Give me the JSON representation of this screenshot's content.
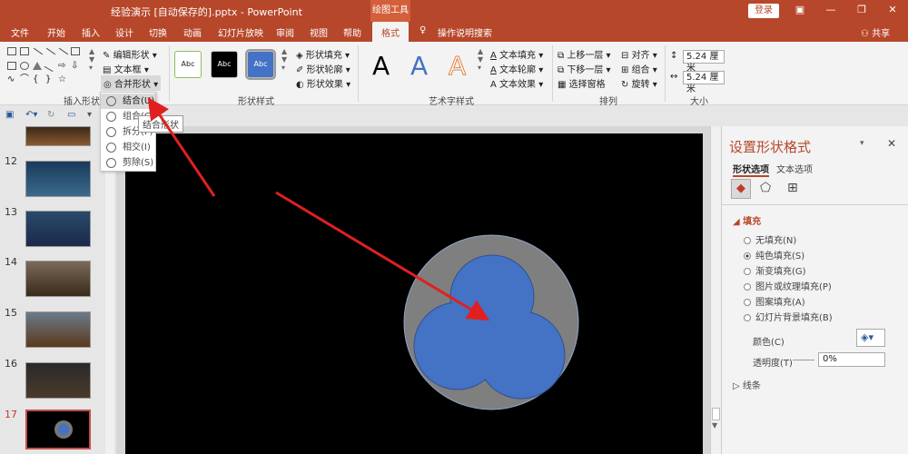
{
  "titlebar": {
    "title": "经验演示 [自动保存的].pptx - PowerPoint",
    "context_tool": "绘图工具",
    "login": "登录",
    "share": "共享"
  },
  "tabs": [
    "文件",
    "开始",
    "插入",
    "设计",
    "切换",
    "动画",
    "幻灯片放映",
    "审阅",
    "视图",
    "帮助",
    "格式"
  ],
  "tell_me": "操作说明搜索",
  "ribbon": {
    "insert_shapes": {
      "label": "插入形状",
      "edit_shape": "编辑形状",
      "text_box": "文本框",
      "merge_shapes": "合并形状"
    },
    "shape_styles": {
      "label": "形状样式",
      "preset_text": "Abc",
      "fill": "形状填充",
      "outline": "形状轮廓",
      "effects": "形状效果"
    },
    "wordart": {
      "label": "艺术字样式",
      "letters": [
        "A",
        "A",
        "A"
      ],
      "text_fill": "文本填充",
      "text_outline": "文本轮廓",
      "text_effects": "文本效果"
    },
    "arrange": {
      "label": "排列",
      "bring_forward": "上移一层",
      "send_backward": "下移一层",
      "selection_pane": "选择窗格",
      "align": "对齐",
      "group": "组合",
      "rotate": "旋转"
    },
    "size": {
      "label": "大小",
      "height": "5.24 厘米",
      "width": "5.24 厘米"
    }
  },
  "merge_menu": {
    "items": [
      "结合(U)",
      "组合(C)",
      "拆分(F)",
      "相交(I)",
      "剪除(S)"
    ],
    "tooltip": "结合形状"
  },
  "slides": [
    {
      "num": "12"
    },
    {
      "num": "13"
    },
    {
      "num": "14"
    },
    {
      "num": "15"
    },
    {
      "num": "16"
    },
    {
      "num": "17"
    }
  ],
  "format_pane": {
    "title": "设置形状格式",
    "tab_shape": "形状选项",
    "tab_text": "文本选项",
    "fill_header": "填充",
    "options": [
      "无填充(N)",
      "纯色填充(S)",
      "渐变填充(G)",
      "图片或纹理填充(P)",
      "图案填充(A)",
      "幻灯片背景填充(B)"
    ],
    "color_label": "颜色(C)",
    "transparency_label": "透明度(T)",
    "transparency_value": "0%",
    "line_header": "线条"
  },
  "colors": {
    "accent": "#b7472a",
    "shape_fill": "#4472c4",
    "outer_circle": "#7f7f7f",
    "slide_bg": "#000000",
    "arrow": "#e02020"
  }
}
